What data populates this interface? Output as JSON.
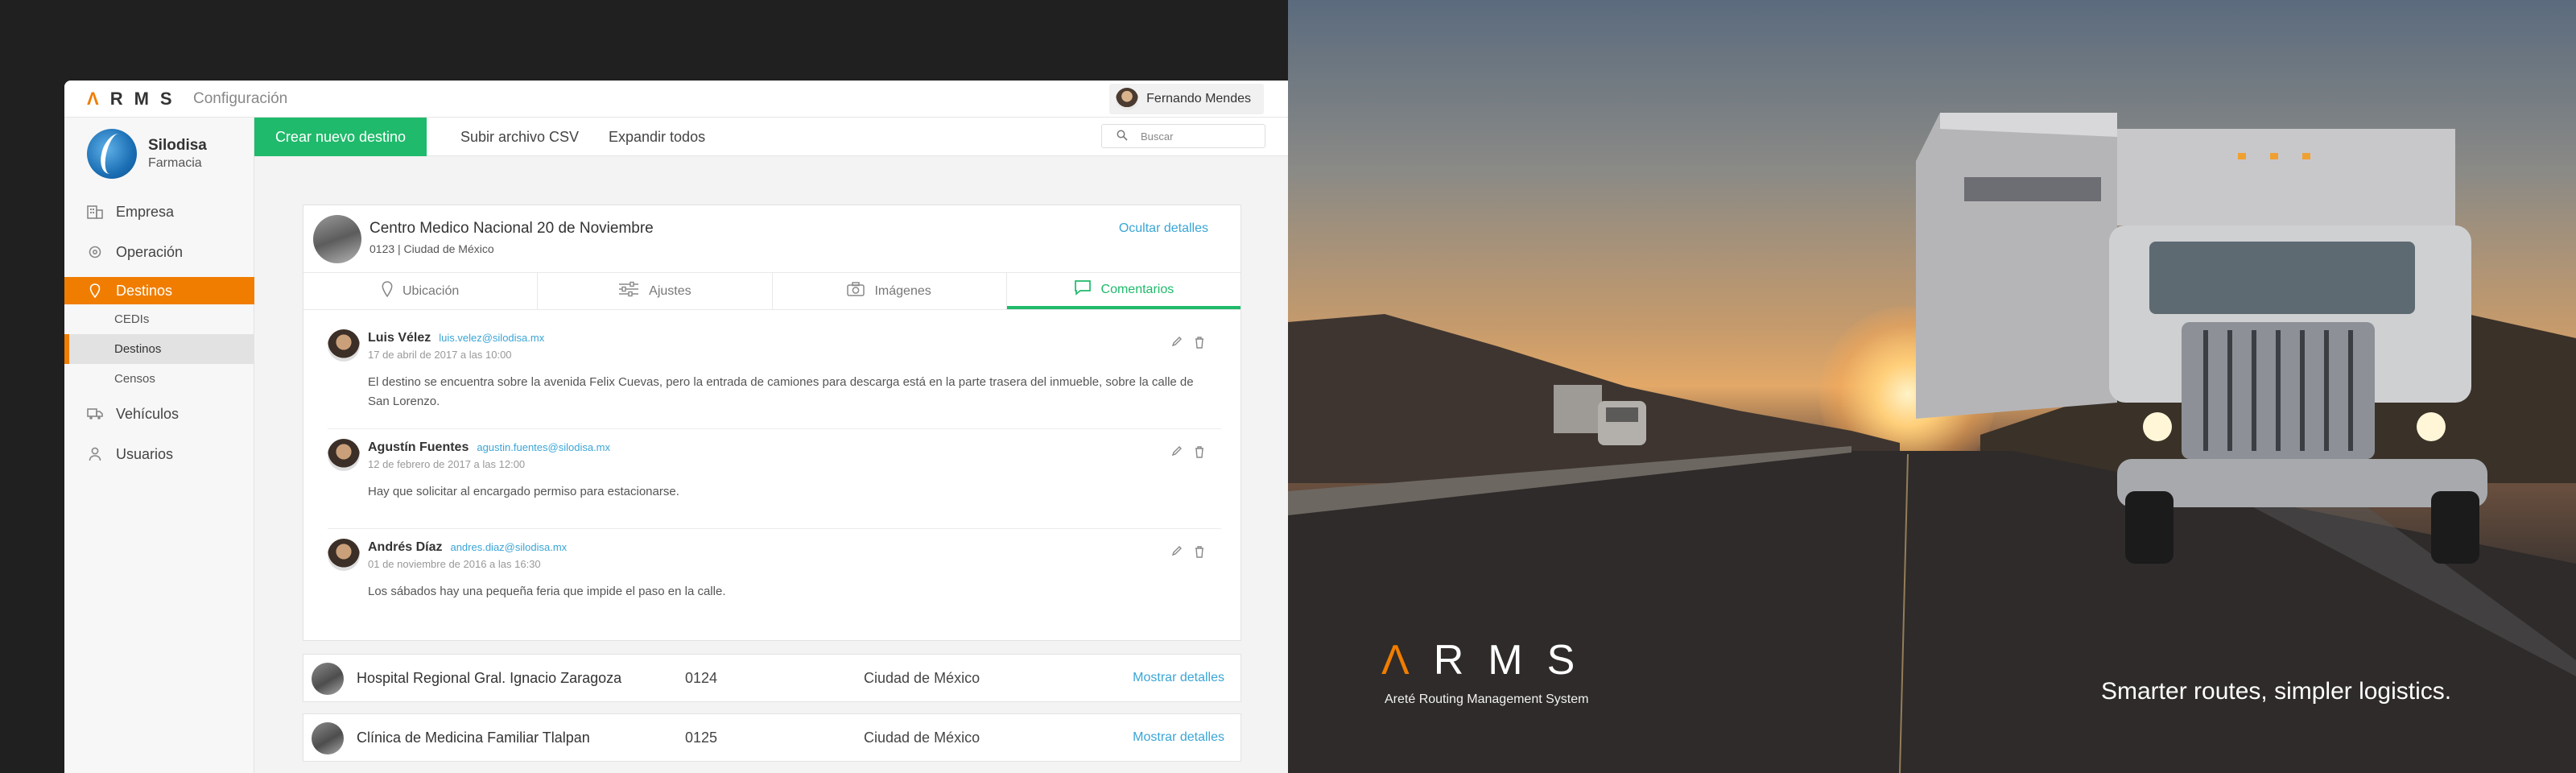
{
  "topbar": {
    "logo_text": "ARMS",
    "section_title": "Configuración",
    "user_name": "Fernando Mendes"
  },
  "sidebar": {
    "brand_name": "Silodisa",
    "brand_subtitle": "Farmacia",
    "items": [
      {
        "label": "Empresa",
        "icon": "building-icon"
      },
      {
        "label": "Operación",
        "icon": "gear-icon"
      },
      {
        "label": "Destinos",
        "icon": "pin-icon",
        "active": true
      },
      {
        "label": "Vehículos",
        "icon": "truck-icon"
      },
      {
        "label": "Usuarios",
        "icon": "user-icon"
      }
    ],
    "subitems": [
      "CEDIs",
      "Destinos",
      "Censos"
    ],
    "selected_subitem": "Destinos"
  },
  "toolbar": {
    "create_label": "Crear nuevo destino",
    "upload_label": "Subir archivo CSV",
    "expand_label": "Expandir todos",
    "search_placeholder": "Buscar"
  },
  "expanded_card": {
    "title": "Centro Medico Nacional 20 de Noviembre",
    "subtitle": "0123 | Ciudad de México",
    "toggle_label": "Ocultar detalles",
    "tabs": [
      {
        "label": "Ubicación",
        "icon": "pin-icon"
      },
      {
        "label": "Ajustes",
        "icon": "sliders-icon"
      },
      {
        "label": "Imágenes",
        "icon": "camera-icon"
      },
      {
        "label": "Comentarios",
        "icon": "comment-icon",
        "active": true
      }
    ],
    "comments": [
      {
        "name": "Luis Vélez",
        "email": "luis.velez@silodisa.mx",
        "date": "17 de abril de 2017 a las 10:00",
        "text": "El destino se encuentra sobre la avenida Felix Cuevas, pero la entrada de camiones para descarga está en la parte trasera del inmueble, sobre la calle de San Lorenzo."
      },
      {
        "name": "Agustín Fuentes",
        "email": "agustin.fuentes@silodisa.mx",
        "date": "12 de febrero de 2017 a las 12:00",
        "text": "Hay que solicitar al encargado permiso para estacionarse."
      },
      {
        "name": "Andrés Díaz",
        "email": "andres.diaz@silodisa.mx",
        "date": "01 de noviembre de 2016 a las 16:30",
        "text": "Los sábados hay una pequeña feria que impide el paso en la calle."
      }
    ]
  },
  "collapsed_rows": [
    {
      "name": "Hospital Regional Gral. Ignacio Zaragoza",
      "code": "0124",
      "city": "Ciudad de México",
      "toggle_label": "Mostrar detalles"
    },
    {
      "name": "Clínica de Medicina Familiar Tlalpan",
      "code": "0125",
      "city": "Ciudad de México",
      "toggle_label": "Mostrar detalles"
    }
  ],
  "hero": {
    "logo_text": "ARMS",
    "logo_subtitle": "Areté Routing Management System",
    "tagline": "Smarter routes, simpler logistics."
  },
  "colors": {
    "accent_orange": "#f07d00",
    "primary_green": "#1fba6b",
    "link_blue": "#3aa5d6"
  }
}
